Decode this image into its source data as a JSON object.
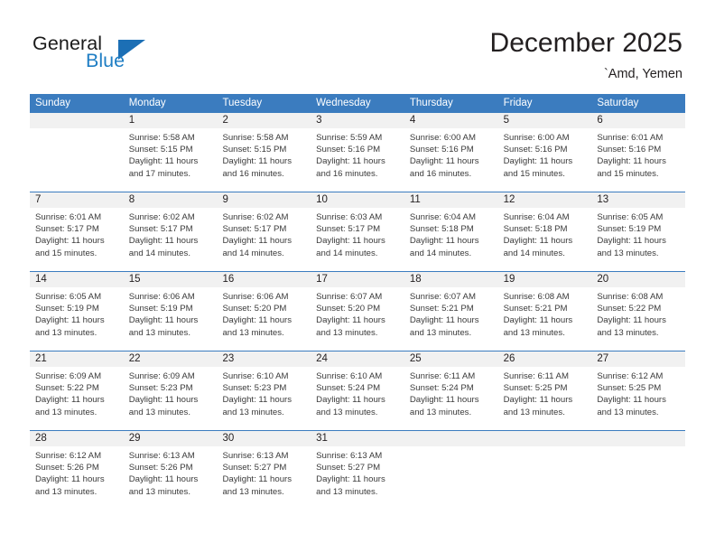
{
  "brand": {
    "name_top": "General",
    "name_bottom": "Blue",
    "flag_icon": "blue-triangle-flag-icon",
    "accent_color": "#1c6fb5"
  },
  "header": {
    "title": "December 2025",
    "subtitle": "`Amd, Yemen"
  },
  "calendar": {
    "header_bg": "#3b7cbf",
    "daynum_bg": "#f1f1f1",
    "weekdays": [
      "Sunday",
      "Monday",
      "Tuesday",
      "Wednesday",
      "Thursday",
      "Friday",
      "Saturday"
    ],
    "weeks": [
      [
        {
          "day": "",
          "sunrise": "",
          "sunset": "",
          "daylight1": "",
          "daylight2": ""
        },
        {
          "day": "1",
          "sunrise": "Sunrise: 5:58 AM",
          "sunset": "Sunset: 5:15 PM",
          "daylight1": "Daylight: 11 hours",
          "daylight2": "and 17 minutes."
        },
        {
          "day": "2",
          "sunrise": "Sunrise: 5:58 AM",
          "sunset": "Sunset: 5:15 PM",
          "daylight1": "Daylight: 11 hours",
          "daylight2": "and 16 minutes."
        },
        {
          "day": "3",
          "sunrise": "Sunrise: 5:59 AM",
          "sunset": "Sunset: 5:16 PM",
          "daylight1": "Daylight: 11 hours",
          "daylight2": "and 16 minutes."
        },
        {
          "day": "4",
          "sunrise": "Sunrise: 6:00 AM",
          "sunset": "Sunset: 5:16 PM",
          "daylight1": "Daylight: 11 hours",
          "daylight2": "and 16 minutes."
        },
        {
          "day": "5",
          "sunrise": "Sunrise: 6:00 AM",
          "sunset": "Sunset: 5:16 PM",
          "daylight1": "Daylight: 11 hours",
          "daylight2": "and 15 minutes."
        },
        {
          "day": "6",
          "sunrise": "Sunrise: 6:01 AM",
          "sunset": "Sunset: 5:16 PM",
          "daylight1": "Daylight: 11 hours",
          "daylight2": "and 15 minutes."
        }
      ],
      [
        {
          "day": "7",
          "sunrise": "Sunrise: 6:01 AM",
          "sunset": "Sunset: 5:17 PM",
          "daylight1": "Daylight: 11 hours",
          "daylight2": "and 15 minutes."
        },
        {
          "day": "8",
          "sunrise": "Sunrise: 6:02 AM",
          "sunset": "Sunset: 5:17 PM",
          "daylight1": "Daylight: 11 hours",
          "daylight2": "and 14 minutes."
        },
        {
          "day": "9",
          "sunrise": "Sunrise: 6:02 AM",
          "sunset": "Sunset: 5:17 PM",
          "daylight1": "Daylight: 11 hours",
          "daylight2": "and 14 minutes."
        },
        {
          "day": "10",
          "sunrise": "Sunrise: 6:03 AM",
          "sunset": "Sunset: 5:17 PM",
          "daylight1": "Daylight: 11 hours",
          "daylight2": "and 14 minutes."
        },
        {
          "day": "11",
          "sunrise": "Sunrise: 6:04 AM",
          "sunset": "Sunset: 5:18 PM",
          "daylight1": "Daylight: 11 hours",
          "daylight2": "and 14 minutes."
        },
        {
          "day": "12",
          "sunrise": "Sunrise: 6:04 AM",
          "sunset": "Sunset: 5:18 PM",
          "daylight1": "Daylight: 11 hours",
          "daylight2": "and 14 minutes."
        },
        {
          "day": "13",
          "sunrise": "Sunrise: 6:05 AM",
          "sunset": "Sunset: 5:19 PM",
          "daylight1": "Daylight: 11 hours",
          "daylight2": "and 13 minutes."
        }
      ],
      [
        {
          "day": "14",
          "sunrise": "Sunrise: 6:05 AM",
          "sunset": "Sunset: 5:19 PM",
          "daylight1": "Daylight: 11 hours",
          "daylight2": "and 13 minutes."
        },
        {
          "day": "15",
          "sunrise": "Sunrise: 6:06 AM",
          "sunset": "Sunset: 5:19 PM",
          "daylight1": "Daylight: 11 hours",
          "daylight2": "and 13 minutes."
        },
        {
          "day": "16",
          "sunrise": "Sunrise: 6:06 AM",
          "sunset": "Sunset: 5:20 PM",
          "daylight1": "Daylight: 11 hours",
          "daylight2": "and 13 minutes."
        },
        {
          "day": "17",
          "sunrise": "Sunrise: 6:07 AM",
          "sunset": "Sunset: 5:20 PM",
          "daylight1": "Daylight: 11 hours",
          "daylight2": "and 13 minutes."
        },
        {
          "day": "18",
          "sunrise": "Sunrise: 6:07 AM",
          "sunset": "Sunset: 5:21 PM",
          "daylight1": "Daylight: 11 hours",
          "daylight2": "and 13 minutes."
        },
        {
          "day": "19",
          "sunrise": "Sunrise: 6:08 AM",
          "sunset": "Sunset: 5:21 PM",
          "daylight1": "Daylight: 11 hours",
          "daylight2": "and 13 minutes."
        },
        {
          "day": "20",
          "sunrise": "Sunrise: 6:08 AM",
          "sunset": "Sunset: 5:22 PM",
          "daylight1": "Daylight: 11 hours",
          "daylight2": "and 13 minutes."
        }
      ],
      [
        {
          "day": "21",
          "sunrise": "Sunrise: 6:09 AM",
          "sunset": "Sunset: 5:22 PM",
          "daylight1": "Daylight: 11 hours",
          "daylight2": "and 13 minutes."
        },
        {
          "day": "22",
          "sunrise": "Sunrise: 6:09 AM",
          "sunset": "Sunset: 5:23 PM",
          "daylight1": "Daylight: 11 hours",
          "daylight2": "and 13 minutes."
        },
        {
          "day": "23",
          "sunrise": "Sunrise: 6:10 AM",
          "sunset": "Sunset: 5:23 PM",
          "daylight1": "Daylight: 11 hours",
          "daylight2": "and 13 minutes."
        },
        {
          "day": "24",
          "sunrise": "Sunrise: 6:10 AM",
          "sunset": "Sunset: 5:24 PM",
          "daylight1": "Daylight: 11 hours",
          "daylight2": "and 13 minutes."
        },
        {
          "day": "25",
          "sunrise": "Sunrise: 6:11 AM",
          "sunset": "Sunset: 5:24 PM",
          "daylight1": "Daylight: 11 hours",
          "daylight2": "and 13 minutes."
        },
        {
          "day": "26",
          "sunrise": "Sunrise: 6:11 AM",
          "sunset": "Sunset: 5:25 PM",
          "daylight1": "Daylight: 11 hours",
          "daylight2": "and 13 minutes."
        },
        {
          "day": "27",
          "sunrise": "Sunrise: 6:12 AM",
          "sunset": "Sunset: 5:25 PM",
          "daylight1": "Daylight: 11 hours",
          "daylight2": "and 13 minutes."
        }
      ],
      [
        {
          "day": "28",
          "sunrise": "Sunrise: 6:12 AM",
          "sunset": "Sunset: 5:26 PM",
          "daylight1": "Daylight: 11 hours",
          "daylight2": "and 13 minutes."
        },
        {
          "day": "29",
          "sunrise": "Sunrise: 6:13 AM",
          "sunset": "Sunset: 5:26 PM",
          "daylight1": "Daylight: 11 hours",
          "daylight2": "and 13 minutes."
        },
        {
          "day": "30",
          "sunrise": "Sunrise: 6:13 AM",
          "sunset": "Sunset: 5:27 PM",
          "daylight1": "Daylight: 11 hours",
          "daylight2": "and 13 minutes."
        },
        {
          "day": "31",
          "sunrise": "Sunrise: 6:13 AM",
          "sunset": "Sunset: 5:27 PM",
          "daylight1": "Daylight: 11 hours",
          "daylight2": "and 13 minutes."
        },
        {
          "day": "",
          "sunrise": "",
          "sunset": "",
          "daylight1": "",
          "daylight2": ""
        },
        {
          "day": "",
          "sunrise": "",
          "sunset": "",
          "daylight1": "",
          "daylight2": ""
        },
        {
          "day": "",
          "sunrise": "",
          "sunset": "",
          "daylight1": "",
          "daylight2": ""
        }
      ]
    ]
  }
}
